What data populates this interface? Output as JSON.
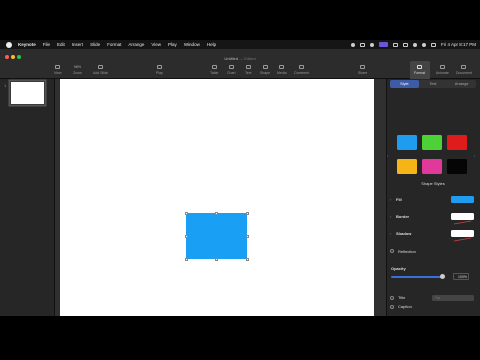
{
  "menubar": {
    "app_name": "Keynote",
    "items": [
      "File",
      "Edit",
      "Insert",
      "Slide",
      "Format",
      "Arrange",
      "View",
      "Play",
      "Window",
      "Help"
    ],
    "datetime": "Fri 4 Apr  8:17 PM"
  },
  "toolbar": {
    "doc_title": "Untitled",
    "doc_status": "— Edited",
    "zoom_value": "96%",
    "items": {
      "view": "View",
      "zoom": "Zoom",
      "add_slide": "Add Slide",
      "play": "Play",
      "table": "Table",
      "chart": "Chart",
      "text": "Text",
      "shape": "Shape",
      "media": "Media",
      "comment": "Comment",
      "share": "Share",
      "format": "Format",
      "animate": "Animate",
      "document": "Document"
    }
  },
  "navigator": {
    "slide_number": "1"
  },
  "inspector": {
    "tabs": [
      "Style",
      "Text",
      "Arrange"
    ],
    "active_tab": "Style",
    "swatches": [
      "#1f9bef",
      "#4cd137",
      "#e01b1b",
      "#f5b516",
      "#e0399a",
      "#050505"
    ],
    "shape_styles_label": "Shape Styles",
    "fill_label": "Fill",
    "fill_color": "#1f9bef",
    "border_label": "Border",
    "shadow_label": "Shadow",
    "reflection_label": "Reflection",
    "opacity_label": "Opacity",
    "opacity_value": "100%",
    "opacity_level": 1.0,
    "title_label": "Title",
    "title_dropdown": "Top",
    "caption_label": "Caption"
  },
  "shape": {
    "color": "#19a0f5"
  }
}
